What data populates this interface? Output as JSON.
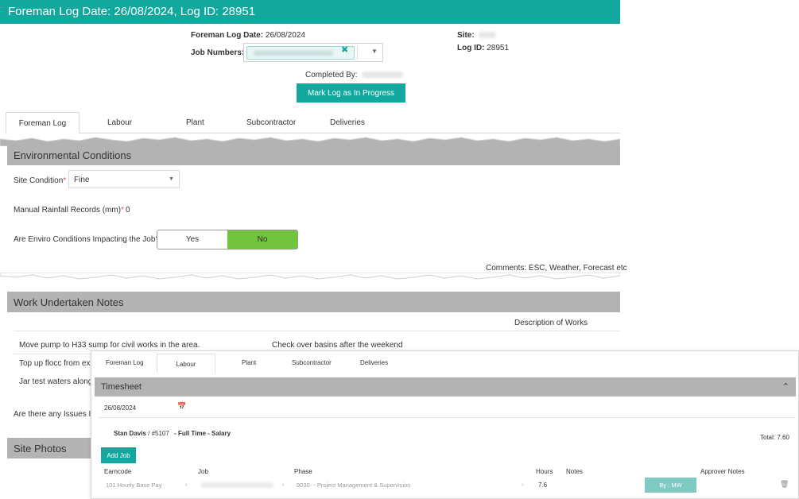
{
  "window": {
    "title": "Foreman Log Date: 26/08/2024, Log ID: 28951"
  },
  "header": {
    "log_date_label": "Foreman Log Date:",
    "log_date_value": "26/08/2024",
    "job_numbers_label": "Job Numbers:",
    "site_label": "Site:",
    "log_id_label": "Log ID:",
    "log_id_value": "28951",
    "completed_by_label": "Completed By:",
    "mark_button": "Mark Log as In Progress"
  },
  "tabs": [
    "Foreman Log",
    "Labour",
    "Plant",
    "Subcontractor",
    "Deliveries"
  ],
  "environmental": {
    "title": "Environmental Conditions",
    "site_condition_label": "Site Condition",
    "site_condition_value": "Fine",
    "rainfall_label": "Manual Rainfall Records (mm)",
    "rainfall_value": "0",
    "impact_question": "Are Enviro Conditions Impacting the Job?",
    "yes_label": "Yes",
    "no_label": "No",
    "comments_label": "Comments: ESC, Weather, Forecast etc"
  },
  "work": {
    "title": "Work Undertaken Notes",
    "description_header": "Description of Works",
    "row1_left": "Move pump to H33 sump for civil works in the area.",
    "row1_right": "Check over basins after the weekend",
    "row2_left": "Top up flocc from exis",
    "row3_left": "Jar test waters along t",
    "issues_question": "Are there any Issues Im"
  },
  "photos": {
    "title": "Site Photos"
  },
  "timesheet": {
    "tabs": [
      "Foreman Log",
      "Labour",
      "Plant",
      "Subcontractor",
      "Deliveries"
    ],
    "title": "Timesheet",
    "date": "26/08/2024",
    "employee_name": "Stan Davis",
    "employee_id": "/ #5107",
    "employment_type": "- Full Time - Salary",
    "total": "Total: 7.60",
    "add_job_button": "Add Job",
    "columns": {
      "earncode": "Earncode",
      "job": "Job",
      "phase": "Phase",
      "hours": "Hours",
      "notes": "Notes",
      "approver_notes": "Approver Notes"
    },
    "row": {
      "earncode": "101 Hourly Base Pay",
      "phase": "9030- - Project Management & Supervision",
      "hours": "7.6",
      "approver": "By : MW"
    }
  }
}
